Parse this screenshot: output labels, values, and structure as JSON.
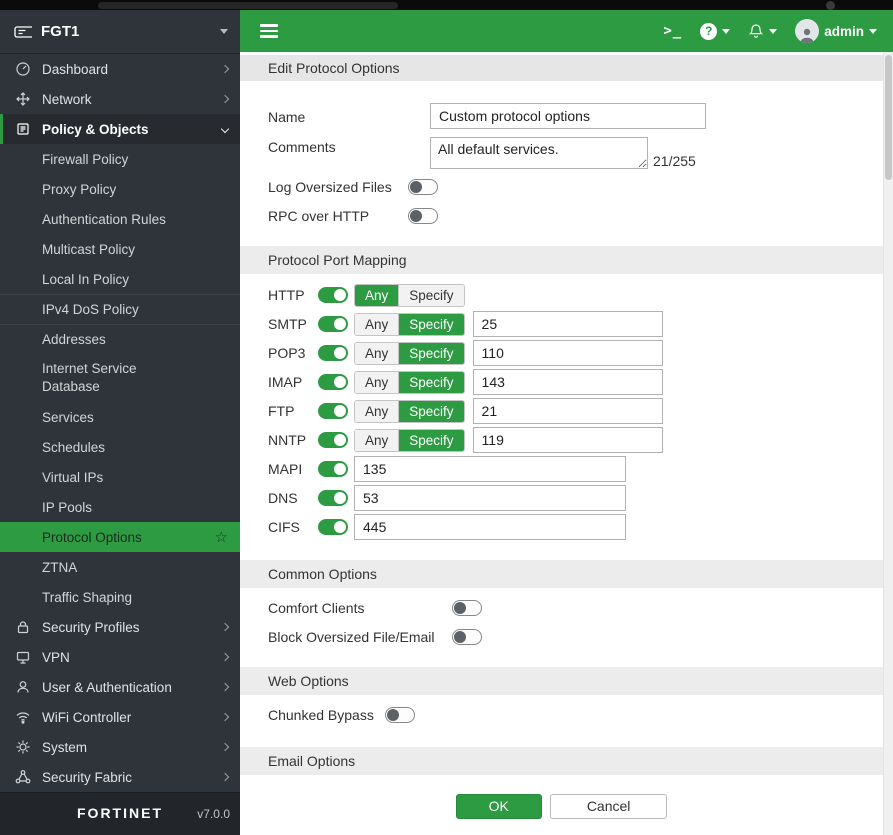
{
  "colors": {
    "accent_green": "#2c9b42",
    "sidebar_bg": "#2f343a"
  },
  "icons": {
    "terminal": ">_",
    "help": "?",
    "favorite_star": "☆"
  },
  "topbar": {
    "admin_label": "admin"
  },
  "sidebar": {
    "hostname": "FGT1",
    "top_items": [
      {
        "label": "Dashboard"
      },
      {
        "label": "Network"
      },
      {
        "label": "Policy & Objects"
      }
    ],
    "policy_children": [
      "Firewall Policy",
      "Proxy Policy",
      "Authentication Rules",
      "Multicast Policy",
      "Local In Policy",
      "IPv4 DoS Policy",
      "Addresses",
      "Internet Service Database",
      "Services",
      "Schedules",
      "Virtual IPs",
      "IP Pools",
      "Protocol Options",
      "ZTNA",
      "Traffic Shaping"
    ],
    "selected_item": "Protocol Options",
    "bottom_items": [
      {
        "label": "Security Profiles"
      },
      {
        "label": "VPN"
      },
      {
        "label": "User & Authentication"
      },
      {
        "label": "WiFi Controller"
      },
      {
        "label": "System"
      },
      {
        "label": "Security Fabric"
      }
    ],
    "brand": "FORTINET",
    "version": "v7.0.0"
  },
  "page": {
    "title": "Edit Protocol Options",
    "form": {
      "name_label": "Name",
      "name_value": "Custom protocol options",
      "comments_label": "Comments",
      "comments_value": "All default services.",
      "comments_counter": "21/255",
      "log_oversized_label": "Log Oversized Files",
      "rpc_http_label": "RPC over HTTP"
    },
    "ppm": {
      "title": "Protocol Port Mapping",
      "any_label": "Any",
      "specify_label": "Specify",
      "rows": [
        {
          "protocol": "HTTP",
          "enabled": true,
          "mode": "any",
          "port": ""
        },
        {
          "protocol": "SMTP",
          "enabled": true,
          "mode": "specify",
          "port": "25"
        },
        {
          "protocol": "POP3",
          "enabled": true,
          "mode": "specify",
          "port": "110"
        },
        {
          "protocol": "IMAP",
          "enabled": true,
          "mode": "specify",
          "port": "143"
        },
        {
          "protocol": "FTP",
          "enabled": true,
          "mode": "specify",
          "port": "21"
        },
        {
          "protocol": "NNTP",
          "enabled": true,
          "mode": "specify",
          "port": "119"
        },
        {
          "protocol": "MAPI",
          "enabled": true,
          "port": "135"
        },
        {
          "protocol": "DNS",
          "enabled": true,
          "port": "53"
        },
        {
          "protocol": "CIFS",
          "enabled": true,
          "port": "445"
        }
      ]
    },
    "common": {
      "title": "Common Options",
      "comfort_label": "Comfort Clients",
      "block_label": "Block Oversized File/Email"
    },
    "web": {
      "title": "Web Options",
      "chunked_label": "Chunked Bypass"
    },
    "email": {
      "title": "Email Options"
    },
    "buttons": {
      "ok": "OK",
      "cancel": "Cancel"
    }
  }
}
